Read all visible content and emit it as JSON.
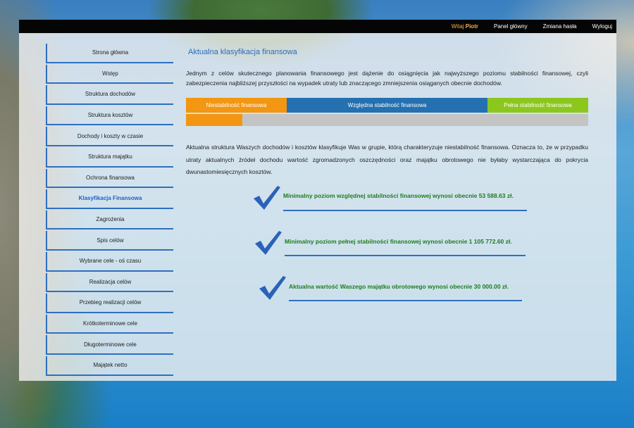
{
  "topbar": {
    "greeting_prefix": "Witaj",
    "user": "Piotr",
    "links": [
      "Panel główny",
      "Zmiana hasła",
      "Wyloguj"
    ]
  },
  "sidebar": {
    "active": "Klasyfikacja Finansowa",
    "items": [
      {
        "label": "Strona główna"
      },
      {
        "label": "Wstęp"
      },
      {
        "label": "Struktura dochodów"
      },
      {
        "label": "Struktura kosztów"
      },
      {
        "label": "Dochody i koszty w czasie"
      },
      {
        "label": "Struktura majątku"
      },
      {
        "label": "Ochrona finansowa"
      },
      {
        "label": "Klasyfikacja Finansowa"
      },
      {
        "label": "Zagrożenia"
      },
      {
        "label": "Spis celów"
      },
      {
        "label": "Wybrane cele - oś czasu"
      },
      {
        "label": "Realizacja celów"
      },
      {
        "label": "Przebieg realizacji celów"
      },
      {
        "label": "Krótkoterminowe cele"
      },
      {
        "label": "Długoterminowe cele"
      },
      {
        "label": "Majątek netto"
      }
    ]
  },
  "main": {
    "title": "Aktualna klasyfikacja finansowa",
    "intro": "Jednym z celów skutecznego planowania finansowego jest dążenie do osiągnięcia jak najwyższego poziomu stabilności finansowej, czyli zabezpieczenia najbliższej przyszłości na wypadek utraty lub znaczącego zmniejszenia osiąganych obecnie dochodów.",
    "scale": {
      "segments": [
        "Niestabilność finansowa",
        "Względna stabilność finansowa",
        "Pełna stabilność finansowa"
      ],
      "colors": [
        "#f39612",
        "#2470b0",
        "#8cc71e"
      ],
      "progress_fraction": 0.14
    },
    "description": "Aktualna struktura Waszych dochodów i kosztów klasyfikuje Was w grupie, którą charakteryzuje niestabilność finansowa. Oznacza to, że w przypadku utraty aktualnych źródeł dochodu wartość zgromadzonych oszczędności oraz majątku obrotowego nie byłaby wystarczająca do pokrycia dwunastomiesięcznych kosztów.",
    "stats": [
      {
        "text": "Minimalny poziom względnej stabilności finansowej wynosi obecnie 53 588.63 zł."
      },
      {
        "text": "Minimalny poziom pełnej stabilności finansowej wynosi obecnie 1 105 772.60 zł."
      },
      {
        "text": "Aktualna wartość Waszego majątku obrotowego wynosi obecnie 30 000.00 zł."
      }
    ]
  },
  "colors": {
    "accent": "#2f6fbf",
    "success_text": "#1d7d1d",
    "greeting": "#f0b050"
  }
}
